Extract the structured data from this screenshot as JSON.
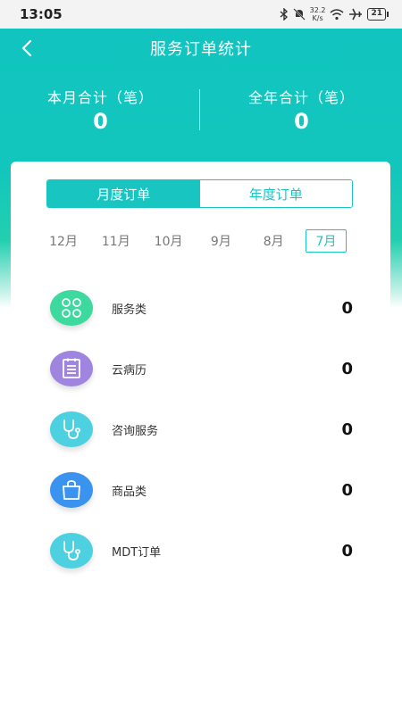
{
  "status_bar": {
    "time": "13:05",
    "net_speed_value": "32.2",
    "net_speed_unit": "K/s",
    "battery": "21",
    "icons": [
      "bluetooth-icon",
      "mute-icon",
      "wifi-icon",
      "airplane-icon",
      "battery-icon"
    ]
  },
  "header": {
    "title": "服务订单统计",
    "back_icon": "back-arrow-icon"
  },
  "summary": {
    "month_label": "本月合计（笔）",
    "month_value": "0",
    "year_label": "全年合计（笔）",
    "year_value": "0"
  },
  "tabs": [
    {
      "label": "月度订单",
      "active": true
    },
    {
      "label": "年度订单",
      "active": false
    }
  ],
  "months": [
    {
      "label": "12月",
      "active": false
    },
    {
      "label": "11月",
      "active": false
    },
    {
      "label": "10月",
      "active": false
    },
    {
      "label": "9月",
      "active": false
    },
    {
      "label": "8月",
      "active": false
    },
    {
      "label": "7月",
      "active": true
    }
  ],
  "categories": [
    {
      "label": "服务类",
      "value": "0",
      "icon": "grid-icon",
      "color": "#3ed99e"
    },
    {
      "label": "云病历",
      "value": "0",
      "icon": "document-icon",
      "color": "#a085e0"
    },
    {
      "label": "咨询服务",
      "value": "0",
      "icon": "stethoscope-icon",
      "color": "#4dd1e0"
    },
    {
      "label": "商品类",
      "value": "0",
      "icon": "shopping-bag-icon",
      "color": "#3b93f0"
    },
    {
      "label": "MDT订单",
      "value": "0",
      "icon": "stethoscope-icon",
      "color": "#4dd1e0"
    }
  ],
  "colors": {
    "accent": "#19c5c0",
    "header_bg": "#11c4c0"
  }
}
